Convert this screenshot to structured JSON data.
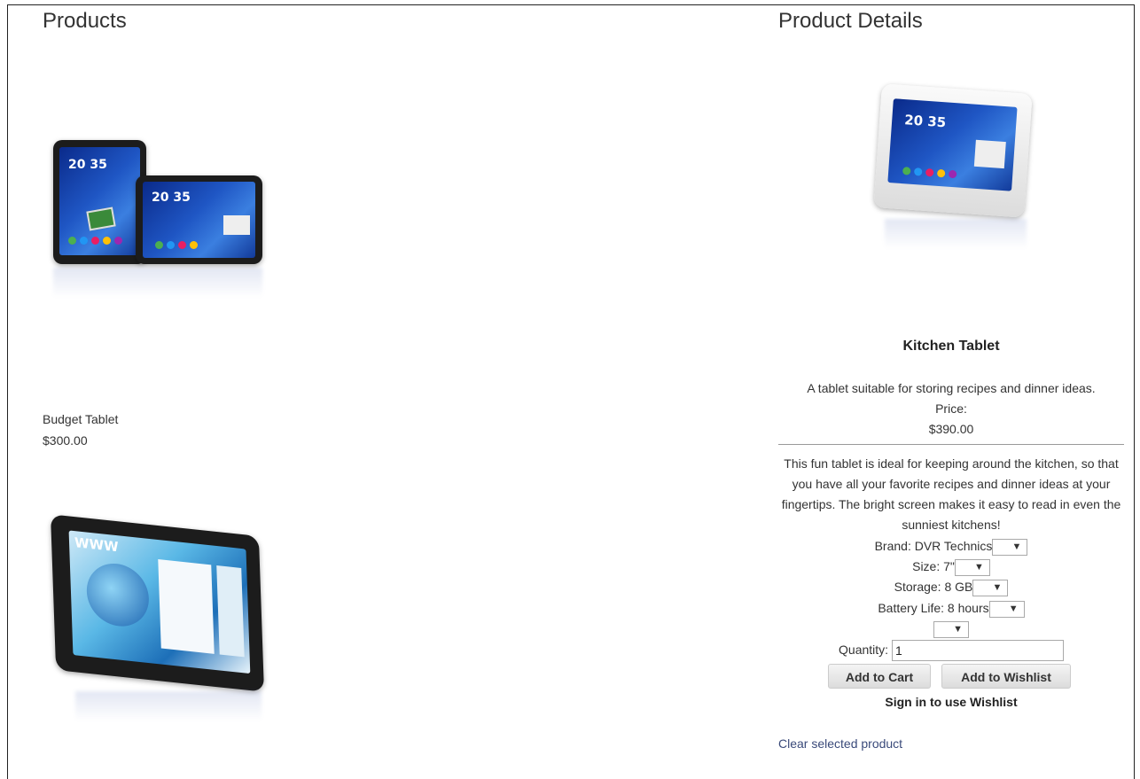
{
  "products": {
    "title": "Products",
    "items": [
      {
        "name": "Budget Tablet",
        "price": "$300.00"
      },
      {
        "name": "",
        "price": ""
      }
    ]
  },
  "details": {
    "title": "Product Details",
    "product_name": "Kitchen Tablet",
    "short_description": "A tablet suitable for storing recipes and dinner ideas.",
    "price_label": "Price:",
    "price": "$390.00",
    "long_description": "This fun tablet is ideal for keeping around the kitchen, so that you have all your favorite recipes and dinner ideas at your fingertips. The bright screen makes it easy to read in even the sunniest kitchens!",
    "attributes": [
      {
        "label": "Brand: DVR Technics"
      },
      {
        "label": "Size: 7\""
      },
      {
        "label": "Storage: 8 GB"
      },
      {
        "label": "Battery Life: 8 hours"
      }
    ],
    "quantity_label": "Quantity:",
    "quantity_value": "1",
    "add_to_cart": "Add to Cart",
    "add_to_wishlist": "Add to Wishlist",
    "signin_note": "Sign in to use Wishlist",
    "clear_link": "Clear selected product"
  },
  "screens": {
    "clock": "20 35"
  },
  "dropdown_arrow": "▼"
}
